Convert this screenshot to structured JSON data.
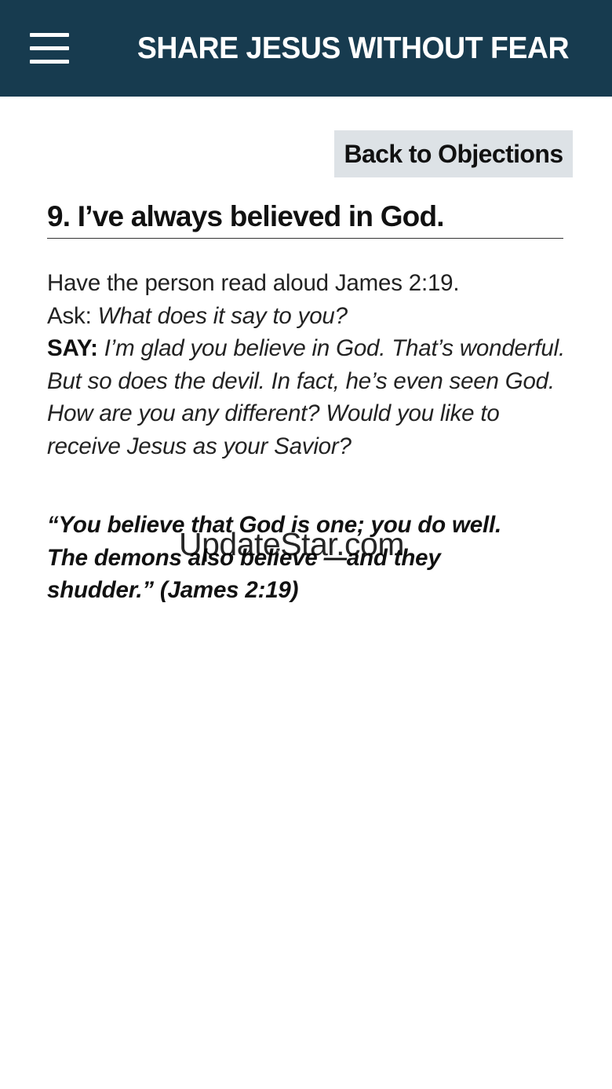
{
  "header": {
    "title": "SHARE JESUS WITHOUT FEAR",
    "menu_icon": "hamburger-menu-icon"
  },
  "back_button": {
    "label": "Back to Objections"
  },
  "objection": {
    "heading": "9. I’ve always believed in God."
  },
  "content": {
    "intro": "Have the person read aloud James 2:19.",
    "ask_label": "Ask: ",
    "ask_question": "What does it say to you?",
    "say_label": "SAY:",
    "say_text": "I’m glad you believe in God. That’s wonderful. But so does the devil. In fact, he’s even seen God. How are you any different? Would you like to receive Jesus as your Savior?"
  },
  "scripture": {
    "quote": "“You believe that God is one; you do well. The demons also believe —and they shudder.” (James 2:19)"
  },
  "watermark": {
    "text": "UpdateStar.com"
  },
  "colors": {
    "header_bg": "#173b4f",
    "button_bg": "#dde2e6"
  }
}
